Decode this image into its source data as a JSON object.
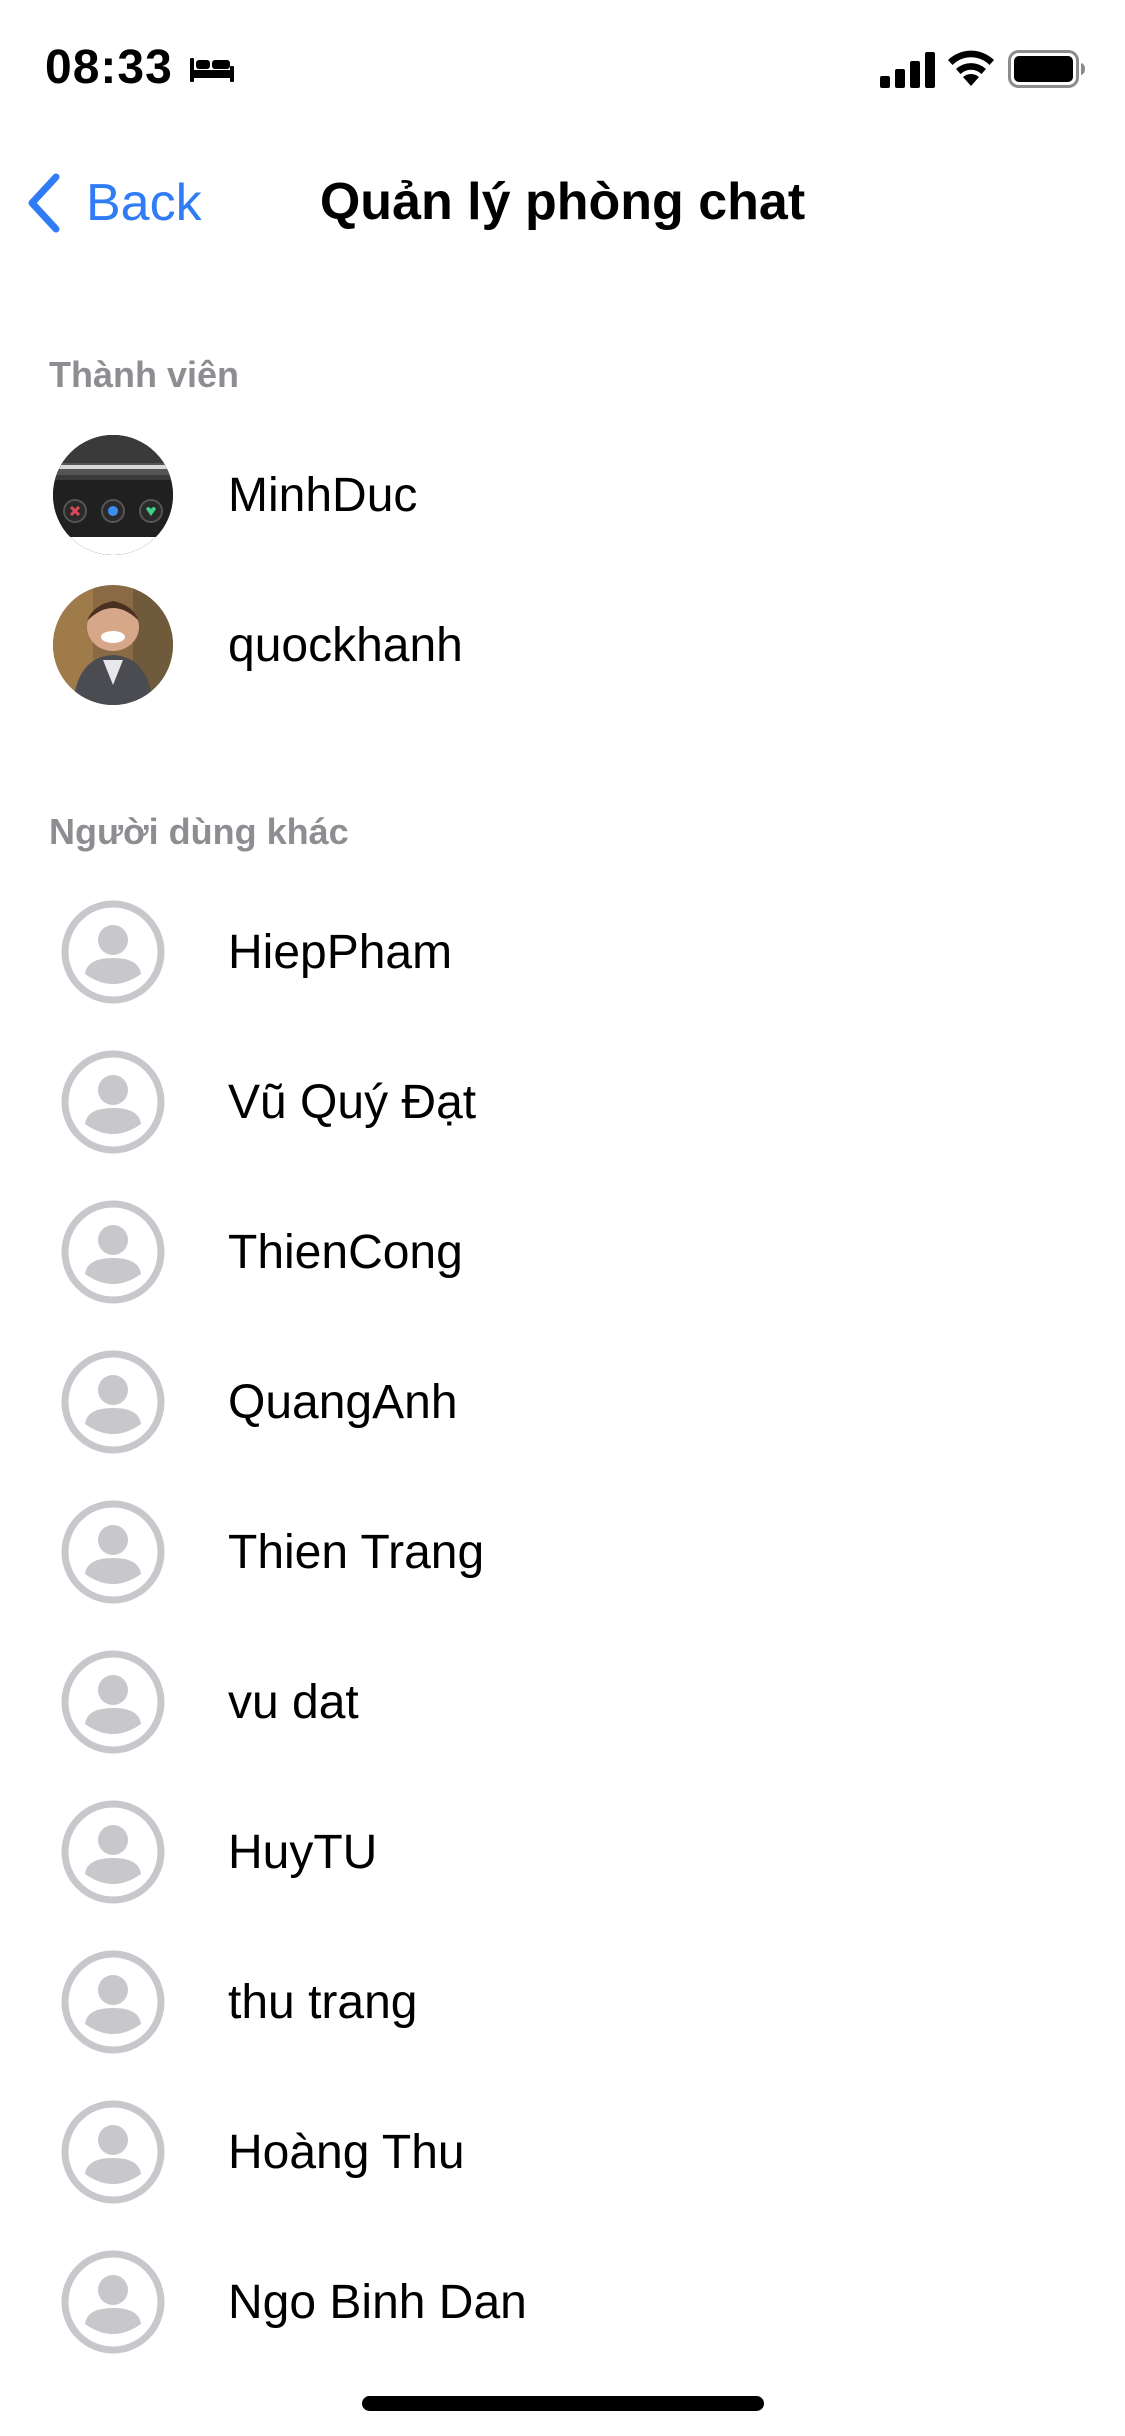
{
  "status_bar": {
    "time": "08:33",
    "sleep_icon": "bed-icon",
    "signal_icon": "cellular-signal-icon",
    "wifi_icon": "wifi-icon",
    "battery_icon": "battery-icon"
  },
  "nav": {
    "back_label": "Back",
    "title": "Quản lý phòng chat"
  },
  "members": {
    "header": "Thành viên",
    "items": [
      {
        "name": "MinhDuc",
        "avatar": "photo"
      },
      {
        "name": "quockhanh",
        "avatar": "photo"
      }
    ]
  },
  "others": {
    "header": "Người dùng khác",
    "items": [
      {
        "name": "HiepPham",
        "avatar": "person-placeholder-icon"
      },
      {
        "name": "Vũ Quý Đạt",
        "avatar": "person-placeholder-icon"
      },
      {
        "name": "ThienCong",
        "avatar": "person-placeholder-icon"
      },
      {
        "name": "QuangAnh",
        "avatar": "person-placeholder-icon"
      },
      {
        "name": "Thien Trang",
        "avatar": "person-placeholder-icon"
      },
      {
        "name": "vu dat",
        "avatar": "person-placeholder-icon"
      },
      {
        "name": "HuyTU",
        "avatar": "person-placeholder-icon"
      },
      {
        "name": "thu trang",
        "avatar": "person-placeholder-icon"
      },
      {
        "name": "Hoàng Thu",
        "avatar": "person-placeholder-icon"
      },
      {
        "name": "Ngo Binh Dan",
        "avatar": "person-placeholder-icon"
      }
    ]
  },
  "colors": {
    "accent": "#2f7cf6",
    "section_header": "#8d8d92",
    "placeholder_gray": "#c7c7cc"
  }
}
